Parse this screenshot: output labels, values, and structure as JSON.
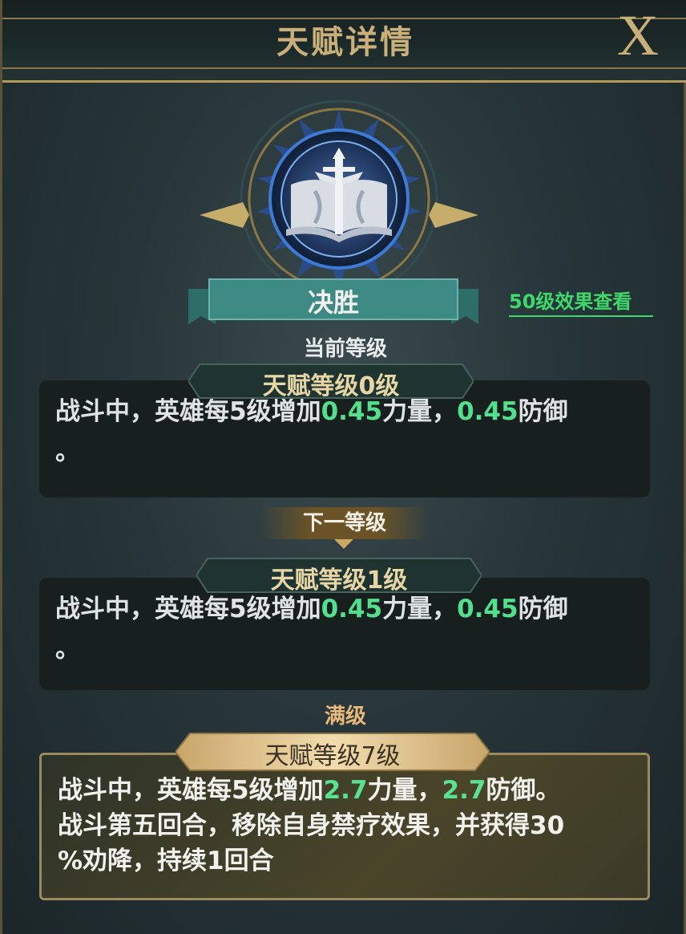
{
  "header": {
    "title": "天赋详情",
    "close_label": "X"
  },
  "talent": {
    "name": "决胜",
    "level50_link": "50级效果查看",
    "icon": "book-sword-icon"
  },
  "current": {
    "section_label": "当前等级",
    "level_label": "天赋等级0级",
    "desc_prefix": "战斗中，英雄每5级增加",
    "value1": "0.45",
    "mid": "力量，",
    "value2": "0.45",
    "suffix": "防御",
    "line2": "。"
  },
  "next": {
    "section_label": "下一等级",
    "level_label": "天赋等级1级",
    "desc_prefix": "战斗中，英雄每5级增加",
    "value1": "0.45",
    "mid": "力量，",
    "value2": "0.45",
    "suffix": "防御",
    "line2": "。"
  },
  "max": {
    "section_label": "满级",
    "level_label": "天赋等级7级",
    "desc_prefix": "战斗中，英雄每5级增加",
    "value1": "2.7",
    "mid": "力量，",
    "value2": "2.7",
    "suffix": "防御。",
    "line2": "战斗第五回合，移除自身禁疗效果，并获得30",
    "line3": "%劝降，持续1回合"
  },
  "colors": {
    "highlight": "#53e08e",
    "gold": "#c9b07a",
    "link_green": "#3fd86a"
  }
}
